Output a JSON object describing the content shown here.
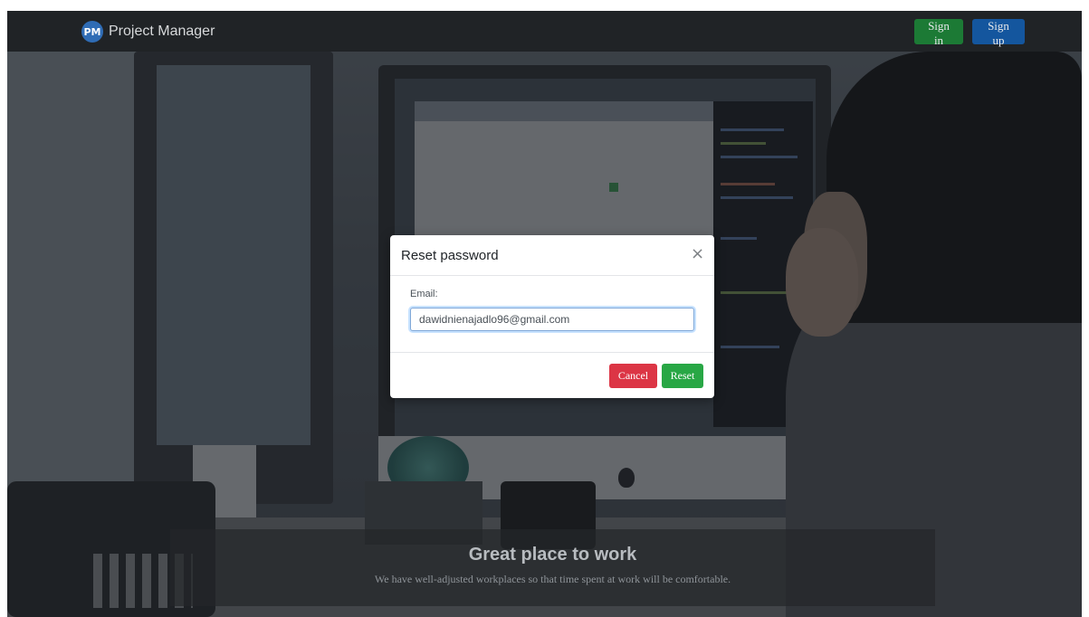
{
  "navbar": {
    "brand_logo_text": "PM",
    "brand_name": "Project Manager",
    "signin_label": "Sign in",
    "signup_label": "Sign up"
  },
  "caption": {
    "title": "Great place to work",
    "text": "We have well-adjusted workplaces so that time spent at work will be comfortable."
  },
  "modal": {
    "title": "Reset password",
    "close_glyph": "×",
    "email_label": "Email:",
    "email_value": "dawidnienajadlo96@gmail.com",
    "cancel_label": "Cancel",
    "reset_label": "Reset"
  },
  "colors": {
    "navbar_bg": "#202326",
    "signin_bg": "#1c7a35",
    "signup_bg": "#14569e",
    "cancel_bg": "#dc3545",
    "reset_bg": "#28a745"
  }
}
